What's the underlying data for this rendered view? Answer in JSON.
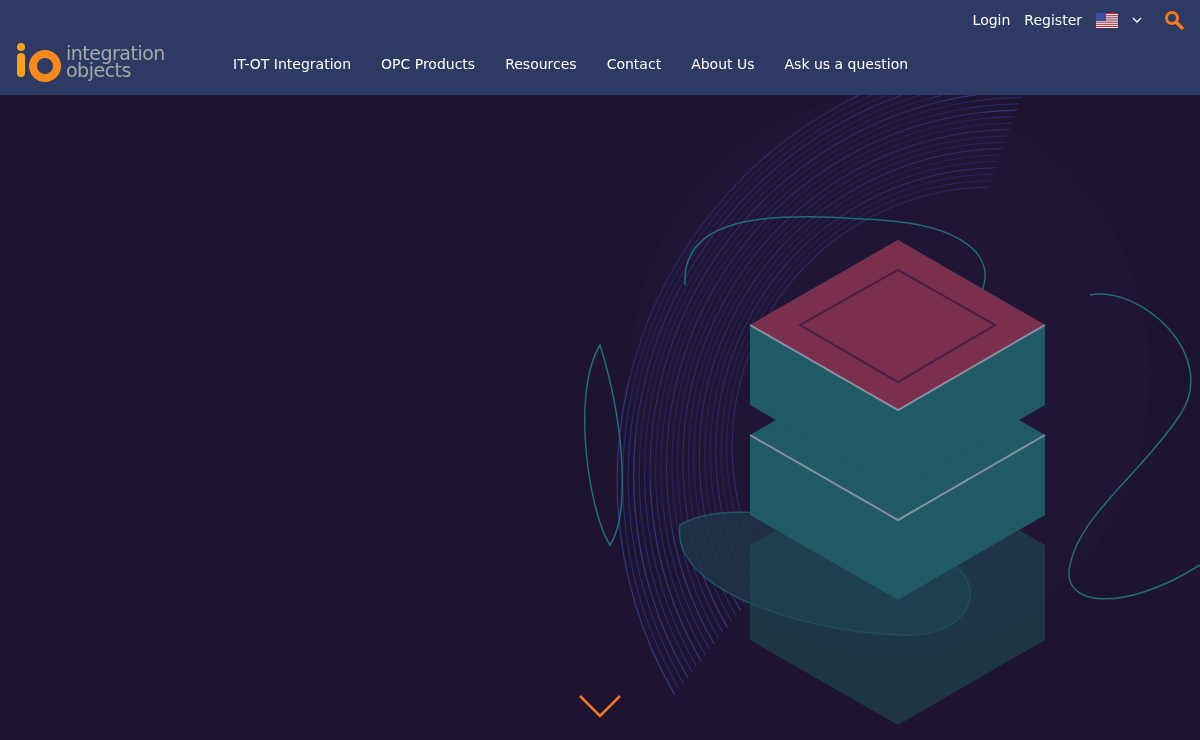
{
  "logo": {
    "lines": [
      "integration",
      "objects"
    ]
  },
  "top_links": [
    "Login",
    "Register"
  ],
  "nav": [
    {
      "label": "IT-OT Integration"
    },
    {
      "label": "OPC Products"
    },
    {
      "label": "Resources"
    },
    {
      "label": "Contact"
    },
    {
      "label": "About Us"
    },
    {
      "label": "Ask us a question"
    }
  ]
}
